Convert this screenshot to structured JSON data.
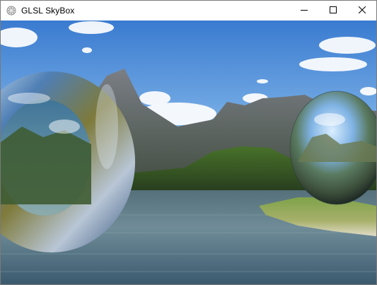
{
  "window": {
    "title": "GLSL SkyBox",
    "controls": {
      "minimize_icon": "minimize-icon",
      "maximize_icon": "maximize-icon",
      "close_icon": "close-icon"
    }
  },
  "scene": {
    "description_colors": {
      "sky_top": "#3d7fd4",
      "sky_bottom": "#9cc7ee",
      "mountain": "#5f6268",
      "water": "#4f6e7d",
      "grass": "#5f8a2e"
    }
  }
}
